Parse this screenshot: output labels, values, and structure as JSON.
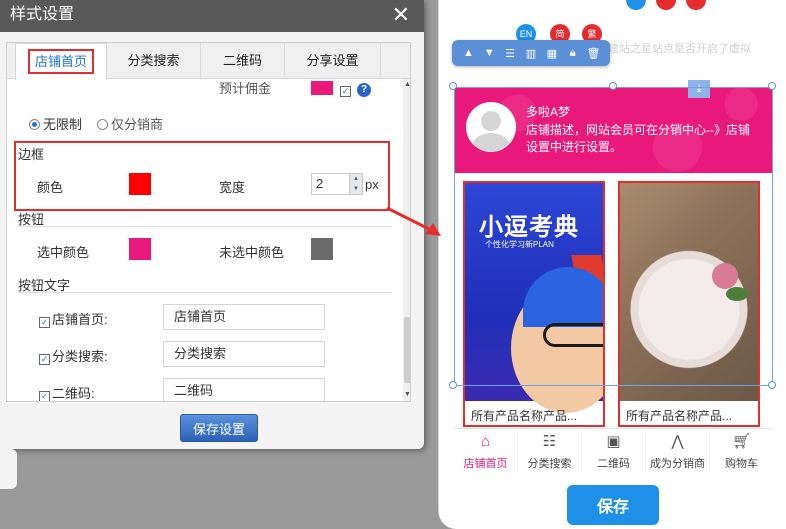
{
  "dialog": {
    "title": "样式设置",
    "close": "✕",
    "tabs": [
      {
        "label": "店铺首页",
        "active": true
      },
      {
        "label": "分类搜索",
        "active": false
      },
      {
        "label": "二维码",
        "active": false
      },
      {
        "label": "分享设置",
        "active": false
      }
    ],
    "commission_label": "预计佣金",
    "commission_color": "#e9197b",
    "commission_checked": "✓",
    "help_mark": "?",
    "radio_unlimited": "无限制",
    "radio_distributor_only": "仅分销商",
    "border_section": "边框",
    "border_color_label": "颜色",
    "border_color": "#ff0000",
    "border_width_label": "宽度",
    "border_width_value": "2",
    "border_width_unit": "px",
    "button_section": "按钮",
    "selected_color_label": "选中颜色",
    "selected_color": "#e9197b",
    "unselected_color_label": "未选中颜色",
    "unselected_color": "#6b6b6b",
    "button_text_section": "按钮文字",
    "button_text_items": [
      {
        "label": "店铺首页:",
        "value": "店铺首页",
        "checked": "✓"
      },
      {
        "label": "分类搜索:",
        "value": "分类搜索",
        "checked": "✓"
      },
      {
        "label": "二维码:",
        "value": "二维码",
        "checked": "✓"
      }
    ],
    "save_button": "保存设置"
  },
  "preview": {
    "lang_en": "EN",
    "lang_simplified": "简",
    "lang_traditional": "繁",
    "bg_text": "建站之星站点是否开启了虚拟",
    "shop_name": "多啦A梦",
    "shop_desc": "店铺描述，网站会员可在分销中心--》店铺设置中进行设置。",
    "products": [
      {
        "caption": "所有产品名称产品...",
        "title": "小逗考典",
        "subtitle": "个性化学习新PLAN"
      },
      {
        "caption": "所有产品名称产品..."
      }
    ],
    "tabbar": [
      {
        "label": "店铺首页",
        "icon": "shop-icon",
        "active": true
      },
      {
        "label": "分类搜索",
        "icon": "search-list-icon",
        "active": false
      },
      {
        "label": "二维码",
        "icon": "qrcode-icon",
        "active": false
      },
      {
        "label": "成为分销商",
        "icon": "share-icon",
        "active": false
      },
      {
        "label": "购物车",
        "icon": "cart-icon",
        "active": false
      }
    ],
    "save_button": "保存",
    "accent_color": "#e9197b",
    "save_color": "#1e90e8"
  }
}
